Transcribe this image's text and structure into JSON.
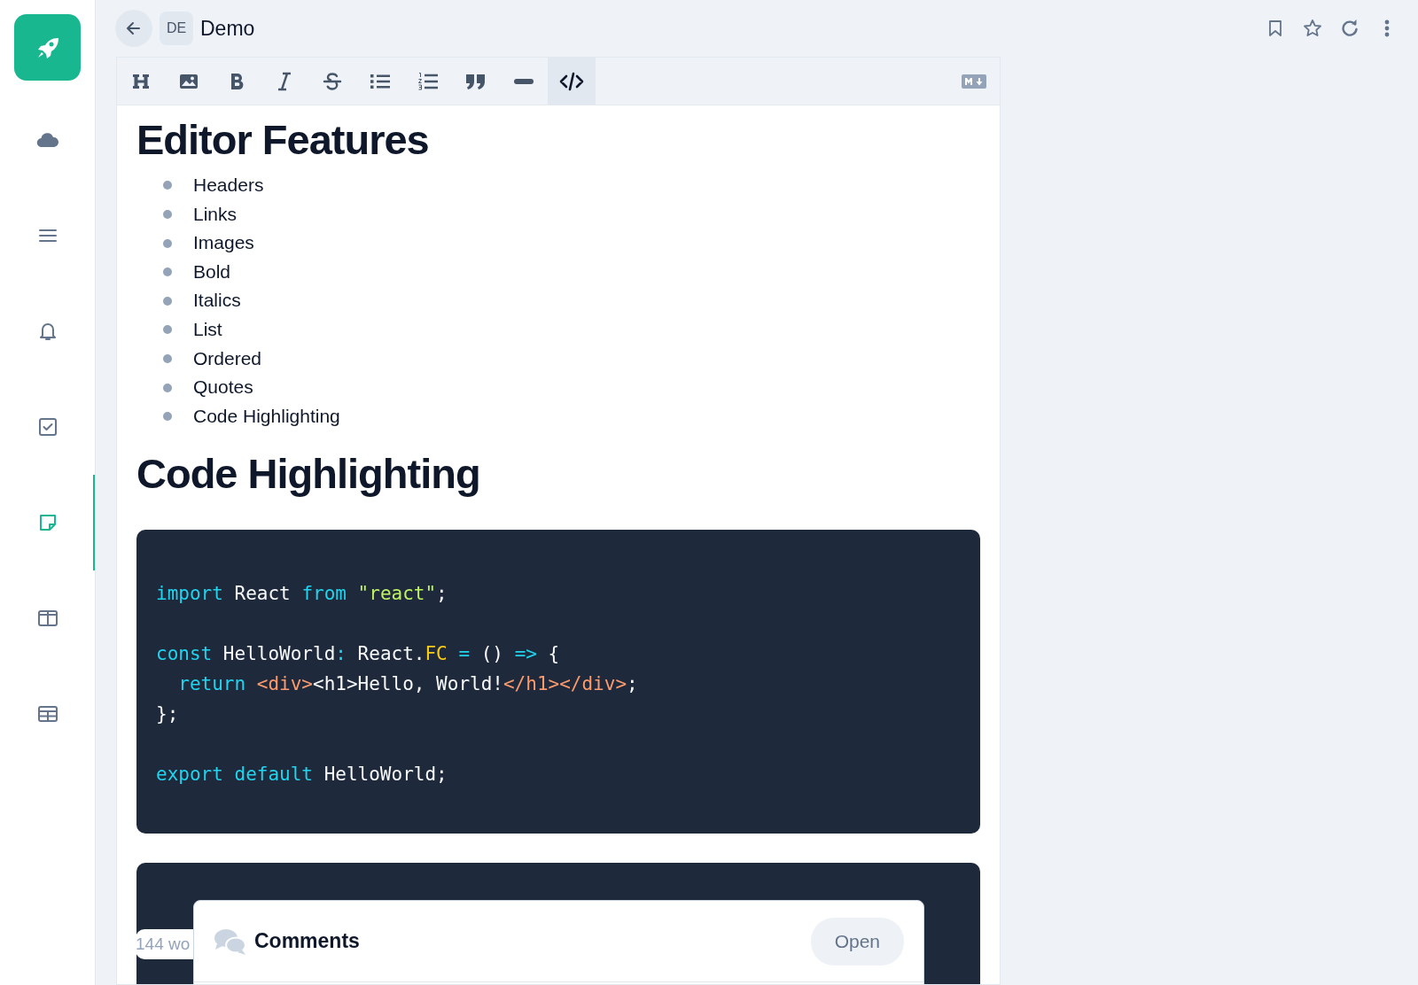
{
  "sidebar": {
    "items": [
      {
        "selected": false
      },
      {
        "selected": false
      },
      {
        "selected": false
      },
      {
        "selected": false
      },
      {
        "selected": true
      },
      {
        "selected": false
      },
      {
        "selected": false
      }
    ]
  },
  "header": {
    "initials": "DE",
    "title": "Demo"
  },
  "toolbar": {
    "buttons": [
      {
        "selected": false
      },
      {
        "selected": false
      },
      {
        "selected": false
      },
      {
        "selected": false
      },
      {
        "selected": false
      },
      {
        "selected": false
      },
      {
        "selected": false
      },
      {
        "selected": false
      },
      {
        "selected": false
      },
      {
        "selected": true
      }
    ]
  },
  "document": {
    "heading_1": "Editor Features",
    "list": [
      "Headers",
      "Links",
      "Images",
      "Bold",
      "Italics",
      "List",
      "Ordered",
      "Quotes",
      "Code Highlighting"
    ],
    "heading_2": "Code Highlighting",
    "code_blocks": [
      [
        {
          "tokens": [
            {
              "kind": "keyword",
              "text": "import"
            },
            {
              "kind": "plain",
              "text": " React "
            },
            {
              "kind": "keyword",
              "text": "from "
            },
            {
              "kind": "string",
              "text": "\"react\""
            },
            {
              "kind": "plain",
              "text": ";"
            }
          ]
        }
      ],
      [
        {
          "tokens": [
            {
              "kind": "keyword",
              "text": "const"
            },
            {
              "kind": "plain",
              "text": " HelloWorld"
            },
            {
              "kind": "keyword",
              "text": ":"
            },
            {
              "kind": "plain",
              "text": " React."
            },
            {
              "kind": "type",
              "text": "FC"
            },
            {
              "kind": "keyword",
              "text": " = "
            },
            {
              "kind": "plain",
              "text": "() "
            },
            {
              "kind": "keyword",
              "text": "=>"
            },
            {
              "kind": "plain",
              "text": " {"
            }
          ]
        },
        {
          "tokens": [
            {
              "kind": "keyword",
              "text": "  return "
            },
            {
              "kind": "tag",
              "text": "<div>"
            },
            {
              "kind": "plain",
              "text": "<h1>Hello, World!"
            },
            {
              "kind": "tag",
              "text": "</h1></div>"
            },
            {
              "kind": "plain",
              "text": ";"
            }
          ]
        },
        {
          "tokens": [
            {
              "kind": "plain",
              "text": "};"
            }
          ]
        }
      ],
      [
        {
          "tokens": [
            {
              "kind": "keyword",
              "text": "export default"
            },
            {
              "kind": "plain",
              "text": " HelloWorld;"
            }
          ]
        }
      ]
    ]
  },
  "word_count": "144 wo",
  "comments": {
    "title": "Comments",
    "button": "Open"
  }
}
